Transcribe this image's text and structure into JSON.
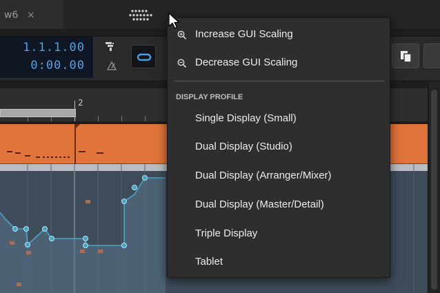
{
  "tab": {
    "title": "w6",
    "close": "×"
  },
  "transport": {
    "position_bars": "1.1.1.00",
    "position_time": "0:00.00"
  },
  "ruler": {
    "bar_label": "2"
  },
  "menu": {
    "scaling": [
      {
        "label": "Increase GUI Scaling",
        "icon": "zoom-in-icon"
      },
      {
        "label": "Decrease GUI Scaling",
        "icon": "zoom-out-icon"
      }
    ],
    "section_header": "DISPLAY PROFILE",
    "profiles": [
      "Single Display (Small)",
      "Dual Display (Studio)",
      "Dual Display (Arranger/Mixer)",
      "Dual Display (Master/Detail)",
      "Triple Display",
      "Tablet"
    ]
  },
  "colors": {
    "clip": "#e0743a",
    "automation_line": "#4aa3c8",
    "counter_text": "#5aa0de",
    "menu_bg": "#2e2e2e"
  }
}
